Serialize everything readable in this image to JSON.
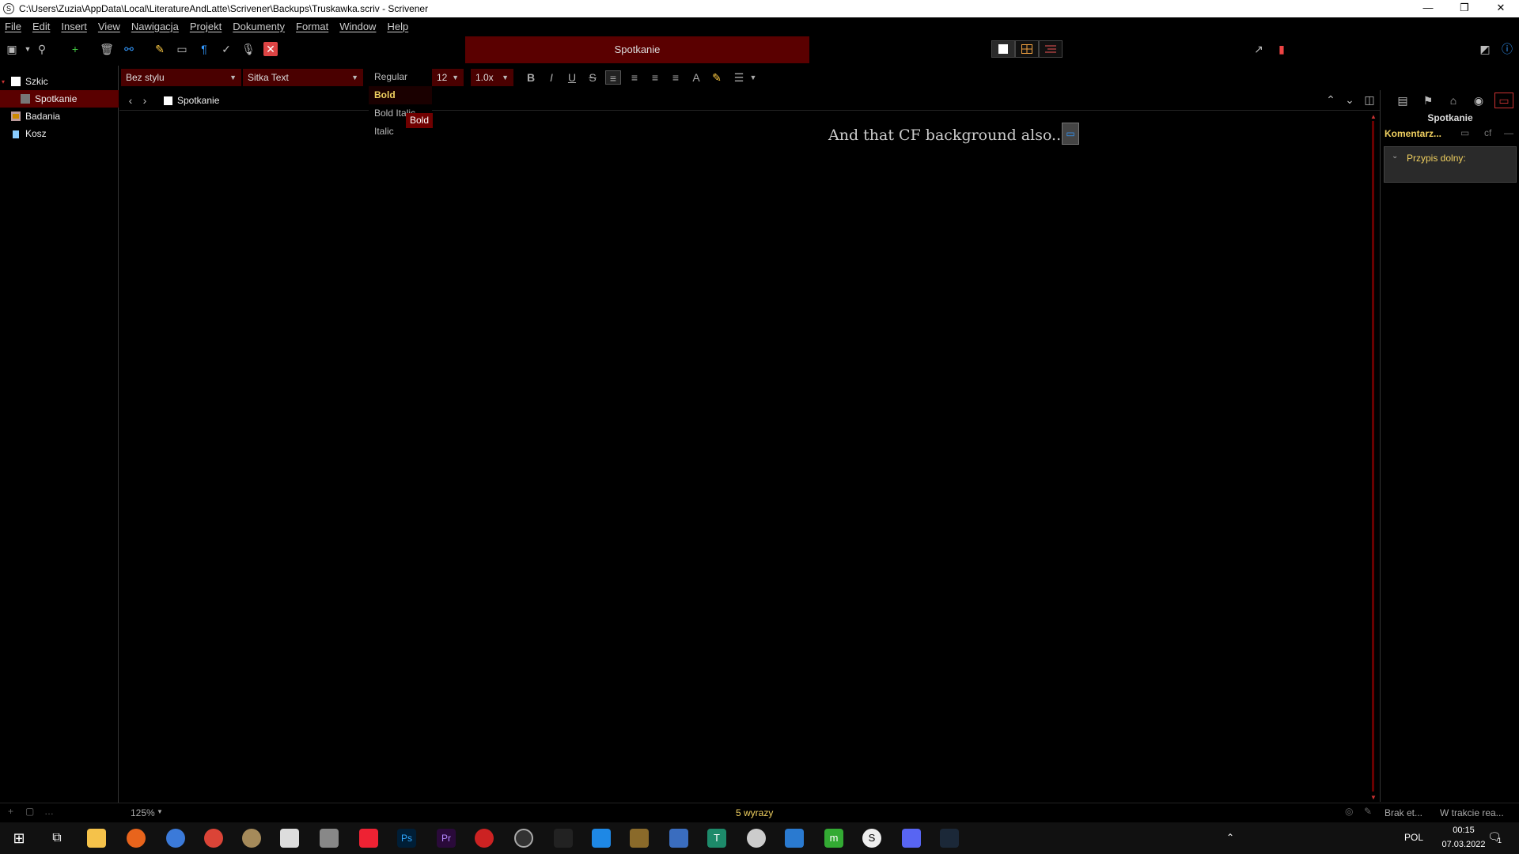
{
  "window": {
    "title": "C:\\Users\\Zuzia\\AppData\\Local\\LiteratureAndLatte\\Scrivener\\Backups\\Truskawka.scriv - Scrivener",
    "minimize": "—",
    "restore": "❐",
    "close": "✕"
  },
  "menu": [
    "File",
    "Edit",
    "Insert",
    "View",
    "Nawigacja",
    "Projekt",
    "Dokumenty",
    "Format",
    "Window",
    "Help"
  ],
  "document_header": "Spotkanie",
  "binder": {
    "items": [
      {
        "label": "Szkic",
        "icon": "draft-folder-icon"
      },
      {
        "label": "Spotkanie",
        "icon": "document-icon"
      },
      {
        "label": "Badania",
        "icon": "research-folder-icon"
      },
      {
        "label": "Kosz",
        "icon": "trash-icon"
      }
    ]
  },
  "format_bar": {
    "style": "Bez stylu",
    "font": "Sitka Text",
    "size": "12",
    "line_spacing": "1.0x",
    "bold": "B",
    "italic": "I",
    "underline": "U",
    "strike": "S",
    "text_color": "A"
  },
  "font_style_menu": {
    "options": [
      "Regular",
      "Bold",
      "Bold Italic",
      "Italic"
    ],
    "highlighted": "Bold",
    "tooltip": "Bold"
  },
  "nav": {
    "doc_title": "Spotkanie"
  },
  "editor": {
    "text": "And that CF background also...",
    "footnote_marker": "▭"
  },
  "inspector": {
    "title": "Spotkanie",
    "tab": "Komentarz...",
    "cf": "cf",
    "footnote_label": "Przypis dolny:"
  },
  "status": {
    "zoom": "125%",
    "word_count": "5 wyrazy",
    "label": "Brak et...",
    "status": "W trakcie rea..."
  },
  "taskbar": {
    "lang": "POL",
    "time": "00:15",
    "date": "07.03.2022",
    "notify": "1"
  },
  "colors": {
    "accent": "#5a0000",
    "highlight_text": "#f0d060",
    "background": "#000000"
  }
}
